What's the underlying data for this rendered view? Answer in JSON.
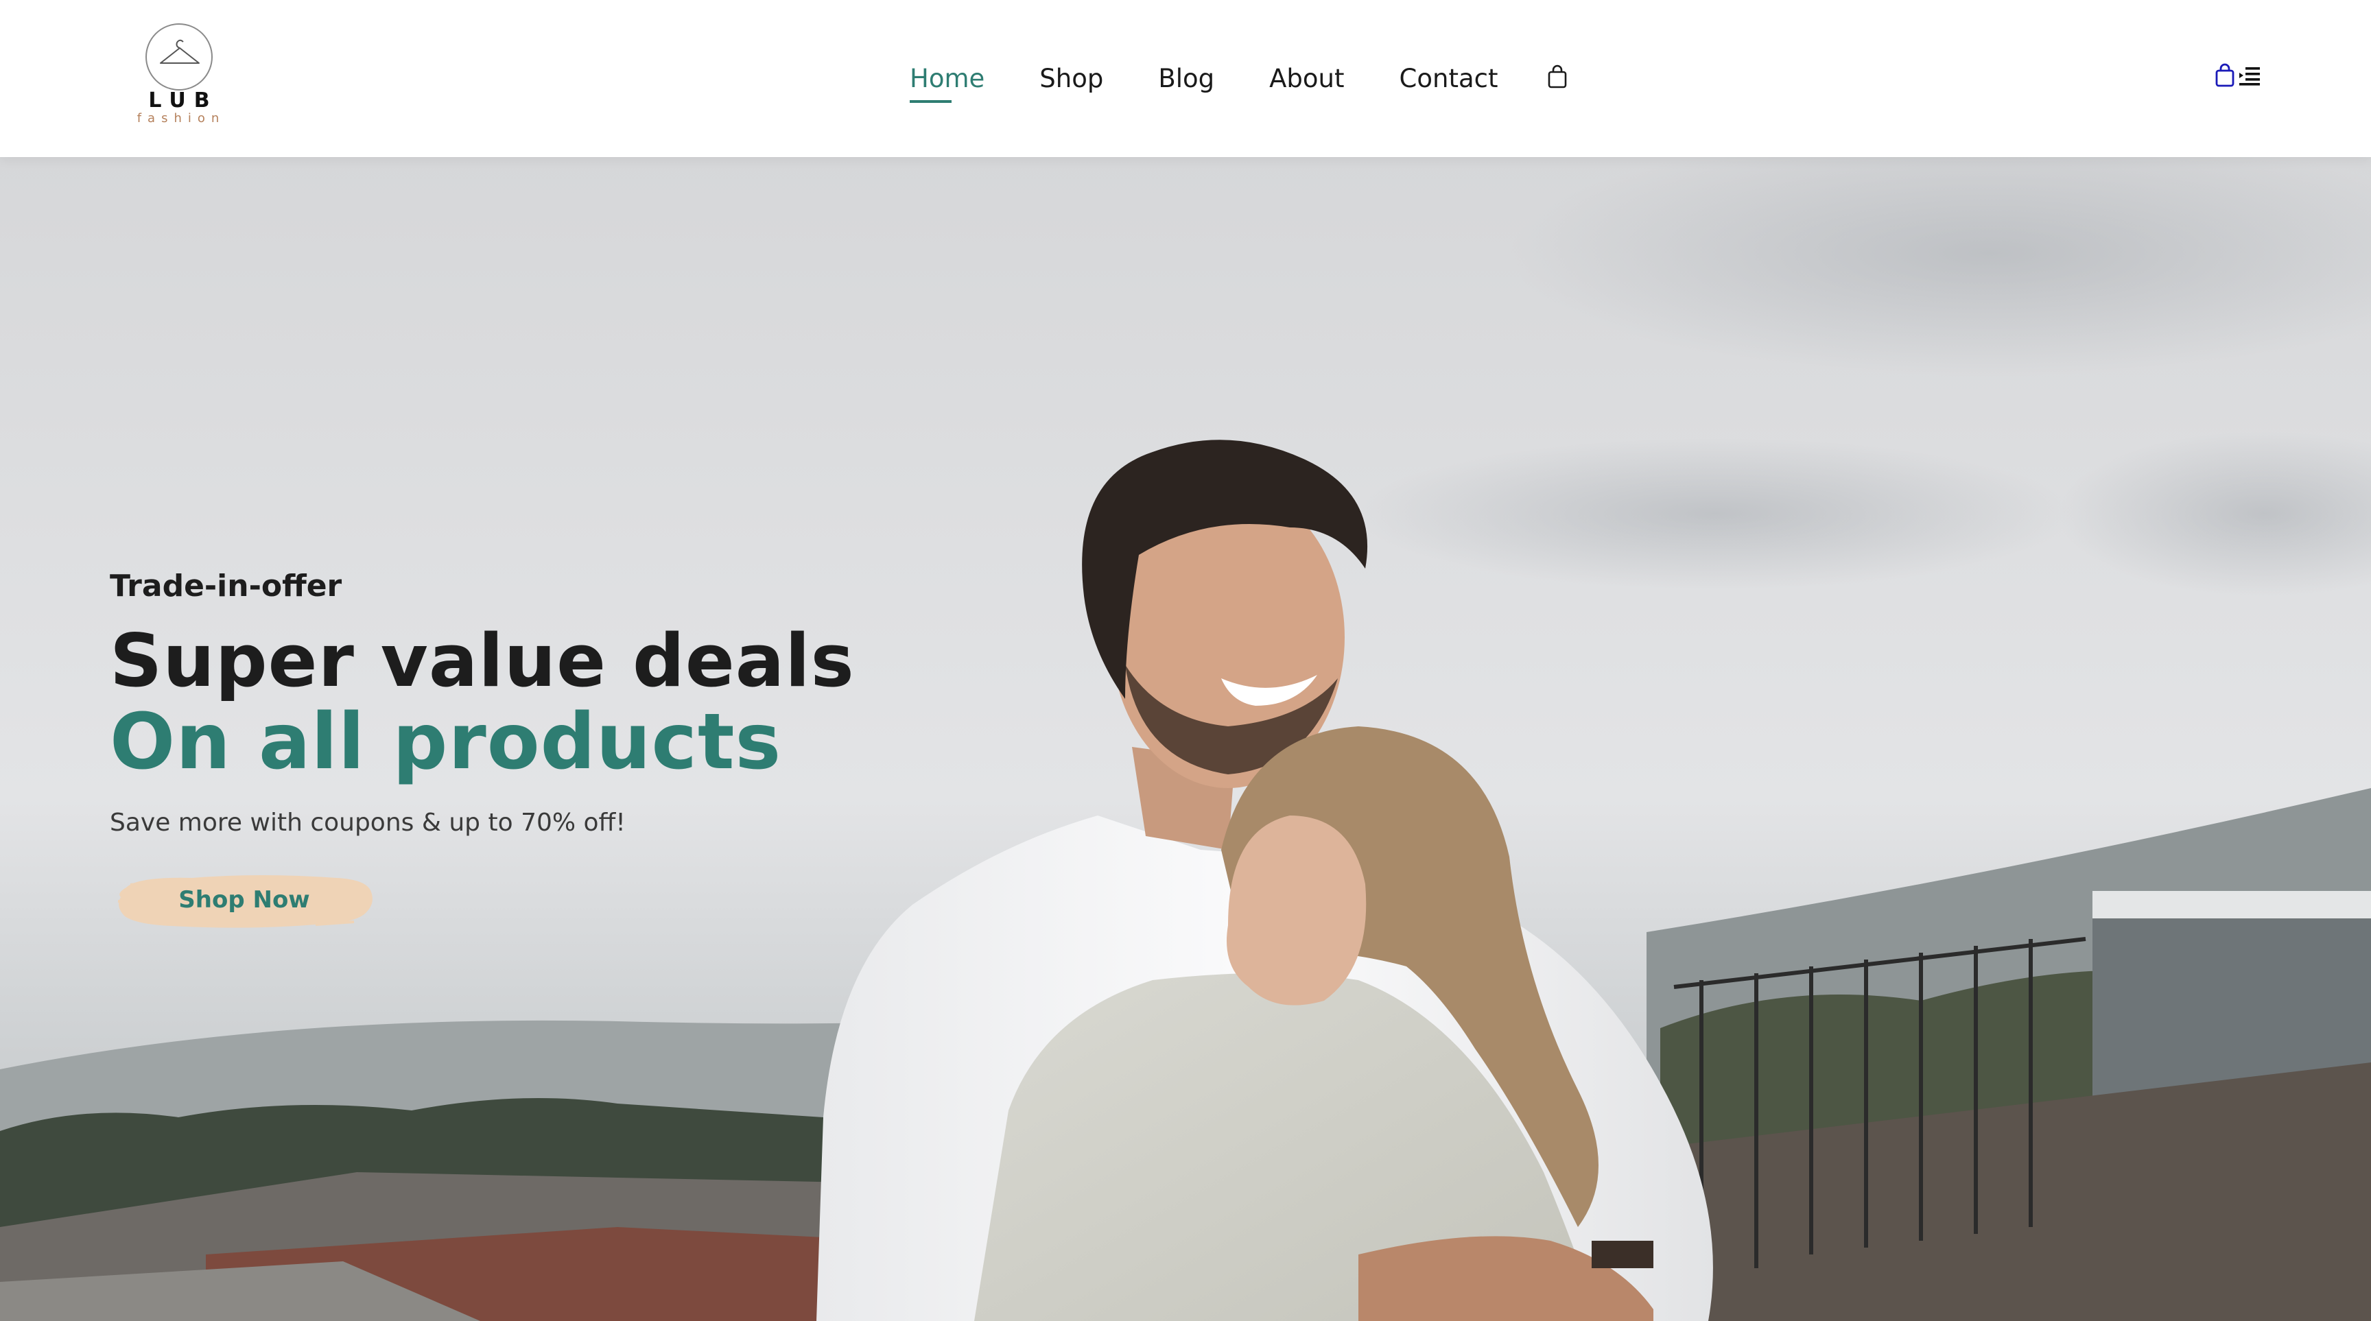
{
  "brand": {
    "name": "LUB",
    "tagline": "fashion",
    "logo_icon": "hanger-icon"
  },
  "nav": {
    "items": [
      {
        "label": "Home",
        "active": true
      },
      {
        "label": "Shop",
        "active": false
      },
      {
        "label": "Blog",
        "active": false
      },
      {
        "label": "About",
        "active": false
      },
      {
        "label": "Contact",
        "active": false
      }
    ],
    "cart_icon": "shopping-bag-icon"
  },
  "mobile_controls": {
    "cart_icon": "shopping-bag-icon",
    "menu_icon": "menu-list-icon"
  },
  "hero": {
    "eyebrow": "Trade-in-offer",
    "headline_line1": "Super value deals",
    "headline_line2": "On all products",
    "subtext": "Save more with coupons & up to 70% off!",
    "cta_label": "Shop Now",
    "image": "couple-embracing-photo"
  },
  "colors": {
    "accent": "#2e7d72",
    "button_brush": "#efd3b6",
    "text_dark": "#1d1d1d",
    "brand_sub": "#b5815c",
    "mobile_icon": "#1a1ab8"
  }
}
